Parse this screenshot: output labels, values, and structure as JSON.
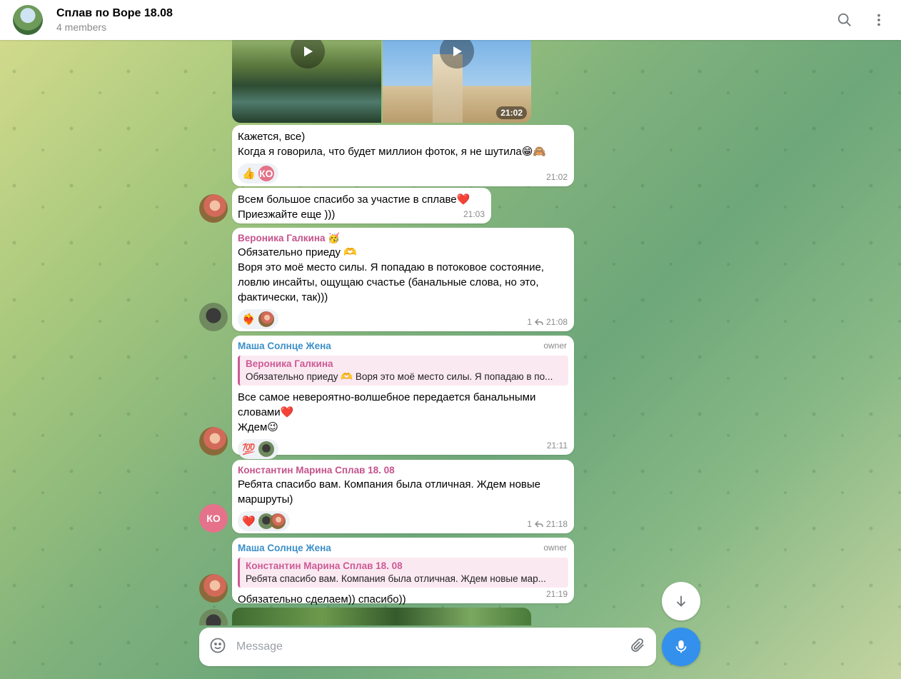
{
  "header": {
    "title": "Сплав по Воре 18.08",
    "subtitle": "4 members",
    "search_icon": "search-icon",
    "more_icon": "more-vertical-icon"
  },
  "messages": [
    {
      "type": "video_album",
      "time": "21:02"
    },
    {
      "lines": [
        "Кажется, все)",
        "Когда я говорила, что будет миллион фоток, я не шутила😁🙈"
      ],
      "reactions": [
        {
          "emoji": "👍"
        },
        {
          "avatar_initials": "КО"
        }
      ],
      "time": "21:02"
    },
    {
      "lines": [
        "Всем большое спасибо за участие в сплаве❤️",
        "Приезжайте еще )))"
      ],
      "time": "21:03"
    },
    {
      "sender": "Вероника Галкина 🥳",
      "sender_color": "#c4538c",
      "lines": [
        "Обязательно приеду 🫶",
        "Воря это моё место силы. Я попадаю в потоковое состояние,",
        "ловлю инсайты, ощущаю счастье (банальные слова, но это,",
        "фактически, так)))"
      ],
      "reactions": [
        {
          "emoji": "❤️‍🔥"
        }
      ],
      "replies_count": "1",
      "time": "21:08"
    },
    {
      "sender": "Маша Солнце Жена",
      "sender_color": "#3c8fc8",
      "badge": "owner",
      "reply": {
        "name": "Вероника Галкина",
        "text": "Обязательно приеду 🫶 Воря это моё место силы. Я попадаю в по..."
      },
      "lines": [
        "Все самое невероятно-волшебное передается банальными",
        "словами❤️",
        "Ждем😉"
      ],
      "reactions": [
        {
          "emoji": "💯"
        }
      ],
      "time": "21:11"
    },
    {
      "sender": "Константин Марина Сплав 18. 08",
      "sender_color": "#c4538c",
      "lines": [
        "Ребята спасибо вам. Компания была отличная. Ждем новые",
        "маршруты)"
      ],
      "reactions": [
        {
          "emoji": "❤️"
        }
      ],
      "replies_count": "1",
      "time": "21:18",
      "author_initials": "КО"
    },
    {
      "sender": "Маша Солнце Жена",
      "sender_color": "#3c8fc8",
      "badge": "owner",
      "reply": {
        "name": "Константин Марина Сплав 18. 08",
        "text": "Ребята спасибо вам. Компания была отличная. Ждем новые мар..."
      },
      "lines": [
        "Обязательно сделаем)) спасибо))"
      ],
      "time": "21:19"
    }
  ],
  "composer": {
    "placeholder": "Message",
    "emoji_icon": "smile-icon",
    "attach_icon": "paperclip-icon"
  },
  "buttons": {
    "scroll_down_icon": "arrow-down-icon",
    "mic_icon": "microphone-icon"
  },
  "colors": {
    "accent": "#3390ec",
    "pink_sender": "#c4538c",
    "blue_sender": "#3c8fc8",
    "avatar_ko": "#e5728a"
  }
}
